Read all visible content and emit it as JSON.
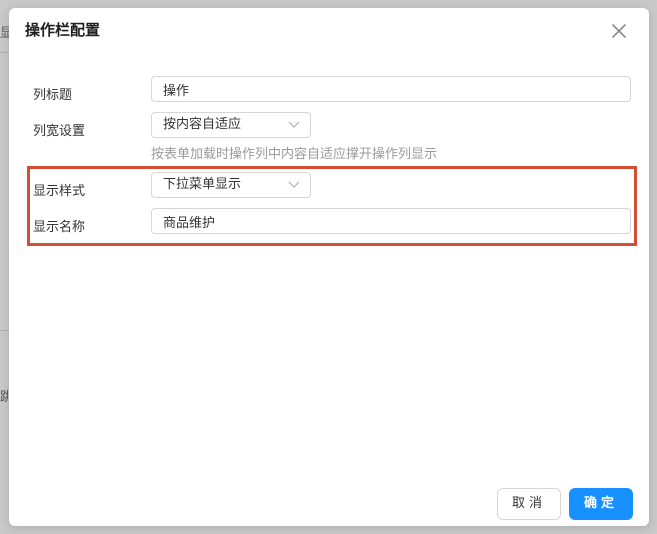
{
  "dialog": {
    "title": "操作栏配置"
  },
  "form": {
    "column_title": {
      "label": "列标题",
      "value": "操作"
    },
    "column_width": {
      "label": "列宽设置",
      "value": "按内容自适应",
      "hint": "按表单加载时操作列中内容自适应撑开操作列显示"
    },
    "display_style": {
      "label": "显示样式",
      "value": "下拉菜单显示"
    },
    "display_name": {
      "label": "显示名称",
      "value": "商品维护"
    }
  },
  "footer": {
    "cancel_label": "取消",
    "ok_label": "确定"
  },
  "background": {
    "frag_1": "显",
    "frag_2": "跳"
  },
  "colors": {
    "primary": "#1890ff",
    "highlight": "#d24f35"
  }
}
